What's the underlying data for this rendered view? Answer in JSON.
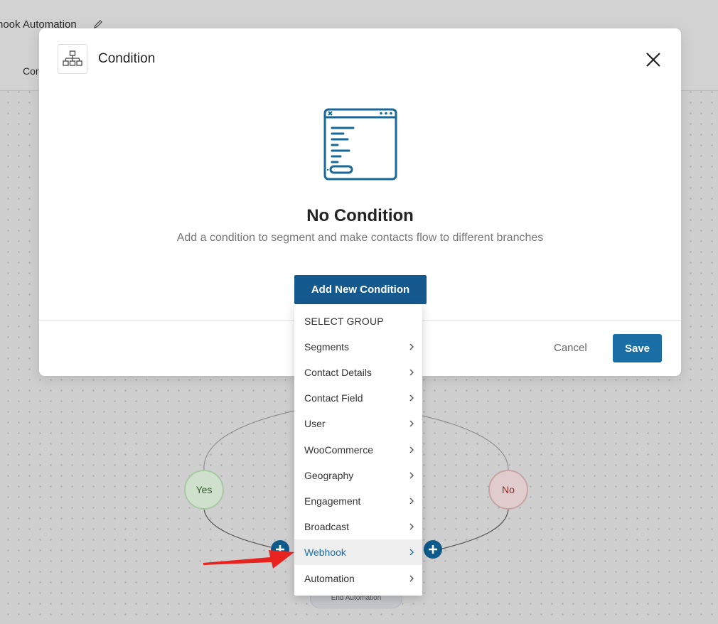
{
  "topbar": {
    "automation_title": "hook Automation",
    "tab_partial": "Cor"
  },
  "modal": {
    "title": "Condition",
    "empty_title": "No Condition",
    "empty_subtitle": "Add a condition to segment and make contacts flow to different branches",
    "add_button": "Add New Condition",
    "cancel_button": "Cancel",
    "save_button": "Save"
  },
  "dropdown": {
    "header": "SELECT GROUP",
    "items": [
      {
        "label": "Segments"
      },
      {
        "label": "Contact Details"
      },
      {
        "label": "Contact Field"
      },
      {
        "label": "User"
      },
      {
        "label": "WooCommerce"
      },
      {
        "label": "Geography"
      },
      {
        "label": "Engagement"
      },
      {
        "label": "Broadcast"
      },
      {
        "label": "Webhook",
        "active": true
      },
      {
        "label": "Automation"
      }
    ]
  },
  "canvas": {
    "yes_label": "Yes",
    "no_label": "No",
    "end_label": "End Automation"
  },
  "colors": {
    "primary": "#155a8f",
    "save": "#1a6ea6",
    "active_text": "#1a6ea6",
    "arrow": "#e8231f"
  }
}
